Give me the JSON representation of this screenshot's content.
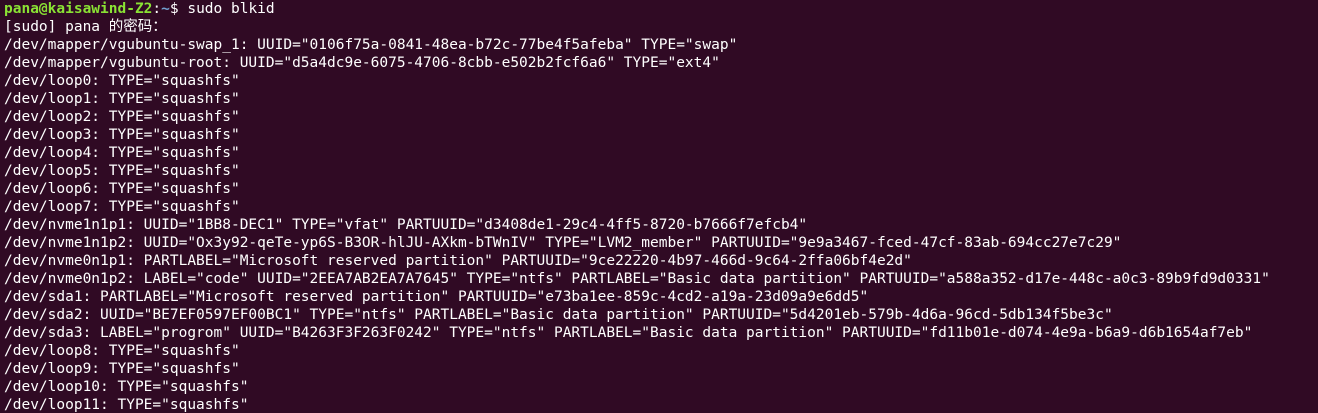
{
  "terminal": {
    "prompt": {
      "user_host": "pana@kaisawind-Z2",
      "separator": ":",
      "path": "~",
      "dollar": "$ ",
      "command": "sudo blkid"
    },
    "lines": [
      "[sudo] pana 的密码：",
      "/dev/mapper/vgubuntu-swap_1: UUID=\"0106f75a-0841-48ea-b72c-77be4f5afeba\" TYPE=\"swap\"",
      "/dev/mapper/vgubuntu-root: UUID=\"d5a4dc9e-6075-4706-8cbb-e502b2fcf6a6\" TYPE=\"ext4\"",
      "/dev/loop0: TYPE=\"squashfs\"",
      "/dev/loop1: TYPE=\"squashfs\"",
      "/dev/loop2: TYPE=\"squashfs\"",
      "/dev/loop3: TYPE=\"squashfs\"",
      "/dev/loop4: TYPE=\"squashfs\"",
      "/dev/loop5: TYPE=\"squashfs\"",
      "/dev/loop6: TYPE=\"squashfs\"",
      "/dev/loop7: TYPE=\"squashfs\"",
      "/dev/nvme1n1p1: UUID=\"1BB8-DEC1\" TYPE=\"vfat\" PARTUUID=\"d3408de1-29c4-4ff5-8720-b7666f7efcb4\"",
      "/dev/nvme1n1p2: UUID=\"Ox3y92-qeTe-yp6S-B3OR-hlJU-AXkm-bTWnIV\" TYPE=\"LVM2_member\" PARTUUID=\"9e9a3467-fced-47cf-83ab-694cc27e7c29\"",
      "/dev/nvme0n1p1: PARTLABEL=\"Microsoft reserved partition\" PARTUUID=\"9ce22220-4b97-466d-9c64-2ffa06bf4e2d\"",
      "/dev/nvme0n1p2: LABEL=\"code\" UUID=\"2EEA7AB2EA7A7645\" TYPE=\"ntfs\" PARTLABEL=\"Basic data partition\" PARTUUID=\"a588a352-d17e-448c-a0c3-89b9fd9d0331\"",
      "/dev/sda1: PARTLABEL=\"Microsoft reserved partition\" PARTUUID=\"e73ba1ee-859c-4cd2-a19a-23d09a9e6dd5\"",
      "/dev/sda2: UUID=\"BE7EF0597EF00BC1\" TYPE=\"ntfs\" PARTLABEL=\"Basic data partition\" PARTUUID=\"5d4201eb-579b-4d6a-96cd-5db134f5be3c\"",
      "/dev/sda3: LABEL=\"progrom\" UUID=\"B4263F3F263F0242\" TYPE=\"ntfs\" PARTLABEL=\"Basic data partition\" PARTUUID=\"fd11b01e-d074-4e9a-b6a9-d6b1654af7eb\"",
      "/dev/loop8: TYPE=\"squashfs\"",
      "/dev/loop9: TYPE=\"squashfs\"",
      "/dev/loop10: TYPE=\"squashfs\"",
      "/dev/loop11: TYPE=\"squashfs\""
    ],
    "colors": {
      "background": "#300a24",
      "text": "#ffffff",
      "prompt_user": "#8ae234",
      "prompt_path": "#729fcf"
    }
  }
}
